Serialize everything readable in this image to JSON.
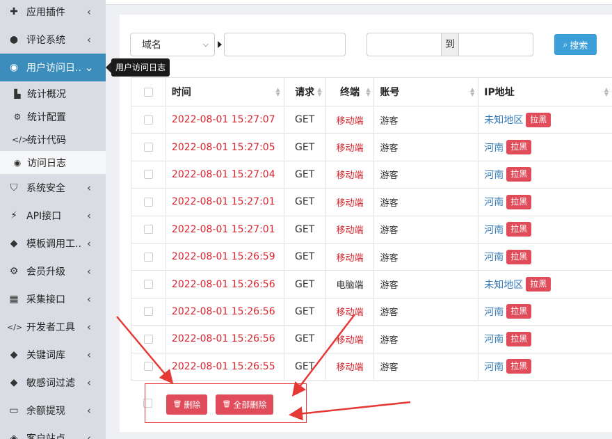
{
  "sidebar": {
    "items": [
      {
        "icon": "puzzle-icon",
        "glyph": "✚",
        "label": "应用插件",
        "chev": "‹"
      },
      {
        "icon": "comments-icon",
        "glyph": "●",
        "label": "评论系统",
        "chev": "‹"
      },
      {
        "icon": "eye-icon",
        "glyph": "◉",
        "label": "用户访问日...",
        "chev": "⌄"
      },
      {
        "icon": "shield-icon",
        "glyph": "⛉",
        "label": "系统安全",
        "chev": "‹"
      },
      {
        "icon": "plug-icon",
        "glyph": "⚡",
        "label": "API接口",
        "chev": "‹"
      },
      {
        "icon": "tag-icon",
        "glyph": "◆",
        "label": "模板调用工...",
        "chev": "‹"
      },
      {
        "icon": "gear-icon",
        "glyph": "⚙",
        "label": "会员升级",
        "chev": "‹"
      },
      {
        "icon": "grid-icon",
        "glyph": "▦",
        "label": "采集接口",
        "chev": "‹"
      },
      {
        "icon": "code-icon",
        "glyph": "</>",
        "label": "开发者工具",
        "chev": "‹"
      },
      {
        "icon": "tags-icon",
        "glyph": "◆",
        "label": "关键词库",
        "chev": "‹"
      },
      {
        "icon": "tag-icon",
        "glyph": "◆",
        "label": "敏感词过滤",
        "chev": "‹"
      },
      {
        "icon": "credit-card-icon",
        "glyph": "▭",
        "label": "余额提现",
        "chev": "‹"
      },
      {
        "icon": "site-icon",
        "glyph": "◈",
        "label": "客户站点",
        "chev": "‹"
      }
    ],
    "subitems": [
      {
        "icon": "bar-chart-icon",
        "glyph": "▙",
        "label": "统计概况"
      },
      {
        "icon": "gear-icon",
        "glyph": "⚙",
        "label": "统计配置"
      },
      {
        "icon": "code-icon",
        "glyph": "</>",
        "label": "统计代码"
      },
      {
        "icon": "eye-icon",
        "glyph": "◉",
        "label": "访问日志"
      }
    ],
    "tooltip": "用户访问日志"
  },
  "filters": {
    "domain_select": "域名",
    "keyword_placeholder": "",
    "date_start_placeholder": "",
    "date_sep": "到",
    "date_end_placeholder": "",
    "search_label": "搜索"
  },
  "table": {
    "headers": [
      "时间",
      "请求",
      "终端",
      "账号",
      "IP地址"
    ],
    "rows": [
      {
        "time": "2022-08-01 15:27:07",
        "method": "GET",
        "terminal": "移动端",
        "account": "游客",
        "ip": "未知地区",
        "tag": "拉黑"
      },
      {
        "time": "2022-08-01 15:27:05",
        "method": "GET",
        "terminal": "移动端",
        "account": "游客",
        "ip": "河南",
        "tag": "拉黑"
      },
      {
        "time": "2022-08-01 15:27:04",
        "method": "GET",
        "terminal": "移动端",
        "account": "游客",
        "ip": "河南",
        "tag": "拉黑"
      },
      {
        "time": "2022-08-01 15:27:01",
        "method": "GET",
        "terminal": "移动端",
        "account": "游客",
        "ip": "河南",
        "tag": "拉黑"
      },
      {
        "time": "2022-08-01 15:27:01",
        "method": "GET",
        "terminal": "移动端",
        "account": "游客",
        "ip": "河南",
        "tag": "拉黑"
      },
      {
        "time": "2022-08-01 15:26:59",
        "method": "GET",
        "terminal": "移动端",
        "account": "游客",
        "ip": "河南",
        "tag": "拉黑"
      },
      {
        "time": "2022-08-01 15:26:56",
        "method": "GET",
        "terminal": "电脑端",
        "account": "游客",
        "ip": "未知地区",
        "tag": "拉黑"
      },
      {
        "time": "2022-08-01 15:26:56",
        "method": "GET",
        "terminal": "移动端",
        "account": "游客",
        "ip": "河南",
        "tag": "拉黑"
      },
      {
        "time": "2022-08-01 15:26:56",
        "method": "GET",
        "terminal": "移动端",
        "account": "游客",
        "ip": "河南",
        "tag": "拉黑"
      },
      {
        "time": "2022-08-01 15:26:55",
        "method": "GET",
        "terminal": "移动端",
        "account": "游客",
        "ip": "河南",
        "tag": "拉黑"
      }
    ]
  },
  "actions": {
    "delete_label": "删除",
    "delete_all_label": "全部删除"
  },
  "colors": {
    "sidebar_active": "#3c8dbc",
    "time_text": "#d9232d",
    "tag_bg": "#e04c5a",
    "link": "#337ab7",
    "search_button": "#3c9fd9",
    "annotation": "#e53935"
  }
}
